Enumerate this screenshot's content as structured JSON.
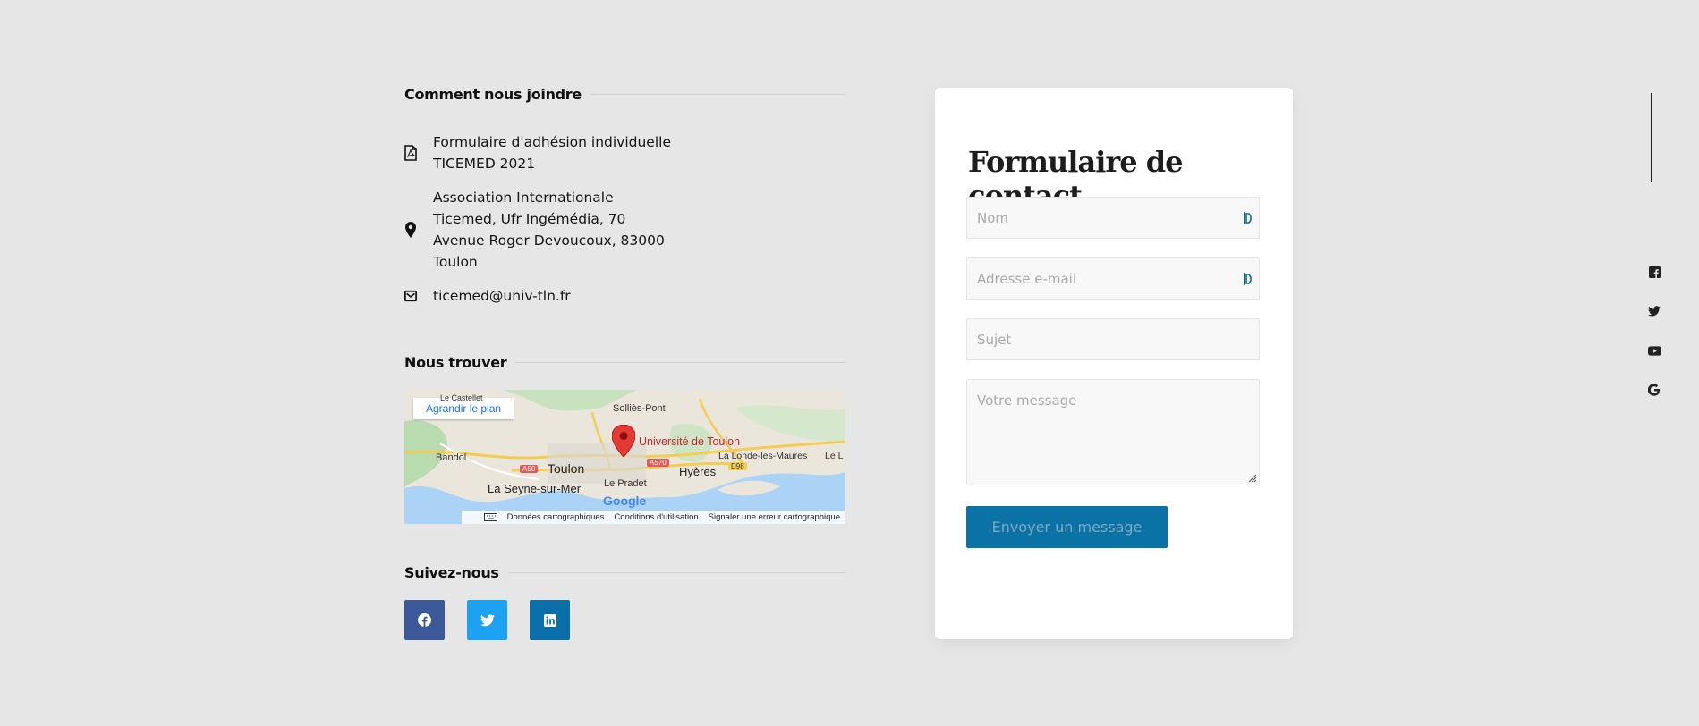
{
  "contact_section": {
    "title": "Comment nous joindre",
    "items": [
      {
        "icon": "pdf-file-icon",
        "lines": [
          "Formulaire d'adhésion individuelle",
          "TICEMED 2021"
        ]
      },
      {
        "icon": "map-pin-icon",
        "lines": [
          "Association Internationale",
          "Ticemed, Ufr Ingémédia, 70",
          "Avenue Roger Devoucoux, 83000",
          "Toulon"
        ]
      },
      {
        "icon": "mail-icon",
        "lines": [
          "ticemed@univ-tln.fr"
        ]
      }
    ]
  },
  "map_section": {
    "title": "Nous trouver",
    "enlarge_button": "Agrandir le plan",
    "places": [
      "Le Castellet",
      "Solliès-Pont",
      "Université de Toulon",
      "Bandol",
      "Toulon",
      "Hyères",
      "La Londe-les-Maures",
      "Le L",
      "Le Pradet",
      "La Seyne-sur-Mer"
    ],
    "roads": [
      "A50",
      "A570",
      "D98"
    ],
    "logo_text": "Google",
    "footer": [
      "Données cartographiques",
      "Conditions d'utilisation",
      "Signaler une erreur cartographique"
    ]
  },
  "follow_section": {
    "title": "Suivez-nous",
    "buttons": [
      {
        "icon": "facebook-icon",
        "color": "#3b5998"
      },
      {
        "icon": "twitter-icon",
        "color": "#1da1f2"
      },
      {
        "icon": "linkedin-icon",
        "color": "#0a6ea8"
      }
    ]
  },
  "contact_form": {
    "title": "Formulaire de contact",
    "name_placeholder": "Nom",
    "email_placeholder": "Adresse e-mail",
    "subject_placeholder": "Sujet",
    "message_placeholder": "Votre message",
    "submit_label": "Envoyer un message"
  },
  "side_icons": [
    "facebook-icon",
    "twitter-icon",
    "youtube-icon",
    "google-icon"
  ],
  "colors": {
    "background": "#e6e6e6",
    "button": "#0b72a6",
    "pin": "#e53935"
  }
}
